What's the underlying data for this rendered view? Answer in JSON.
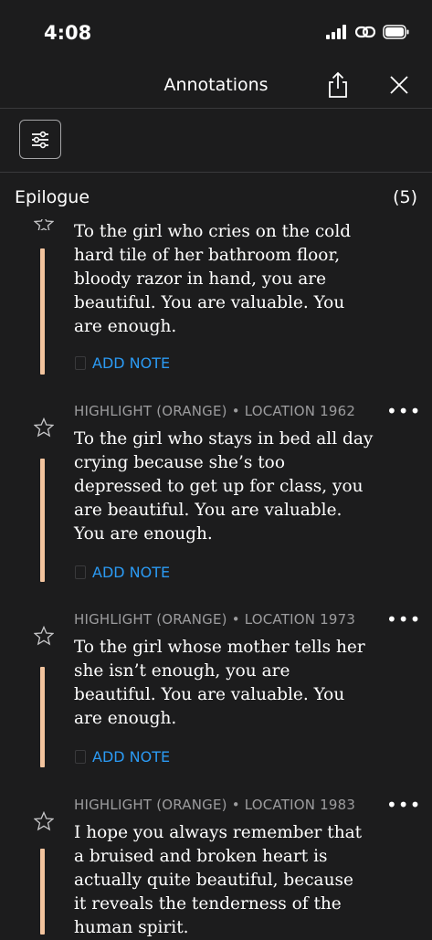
{
  "status_bar": {
    "time": "4:08"
  },
  "header": {
    "title": "Annotations",
    "share_icon": "share-icon",
    "close_icon": "close-icon"
  },
  "filter": {
    "icon": "sliders-icon"
  },
  "section": {
    "title": "Epilogue",
    "count": "(5)"
  },
  "colors": {
    "highlight_orange": "#f2c49e",
    "link_blue": "#2b9af3",
    "background": "#1c1c1d"
  },
  "annotations": [
    {
      "meta": "",
      "text": "To the girl who cries on the cold\nhard tile of her bathroom floor,\nbloody razor in hand, you are\nbeautiful. You are valuable. You\nare enough.",
      "add_note": "ADD NOTE"
    },
    {
      "meta": "HIGHLIGHT (ORANGE) • LOCATION 1962",
      "text": "To the girl who stays in bed all day\ncrying because she’s too\ndepressed to get up for class, you\nare beautiful. You are valuable.\nYou are enough.",
      "add_note": "ADD NOTE"
    },
    {
      "meta": "HIGHLIGHT (ORANGE) • LOCATION 1973",
      "text": "To the girl whose mother tells her\nshe isn’t enough, you are\nbeautiful. You are valuable. You\nare enough.",
      "add_note": "ADD NOTE"
    },
    {
      "meta": "HIGHLIGHT (ORANGE) • LOCATION 1983",
      "text": "I hope you always remember that\na bruised and broken heart is\nactually quite beautiful, because\nit reveals the tenderness of the\nhuman spirit.",
      "add_note": ""
    }
  ],
  "more_label": "•••"
}
